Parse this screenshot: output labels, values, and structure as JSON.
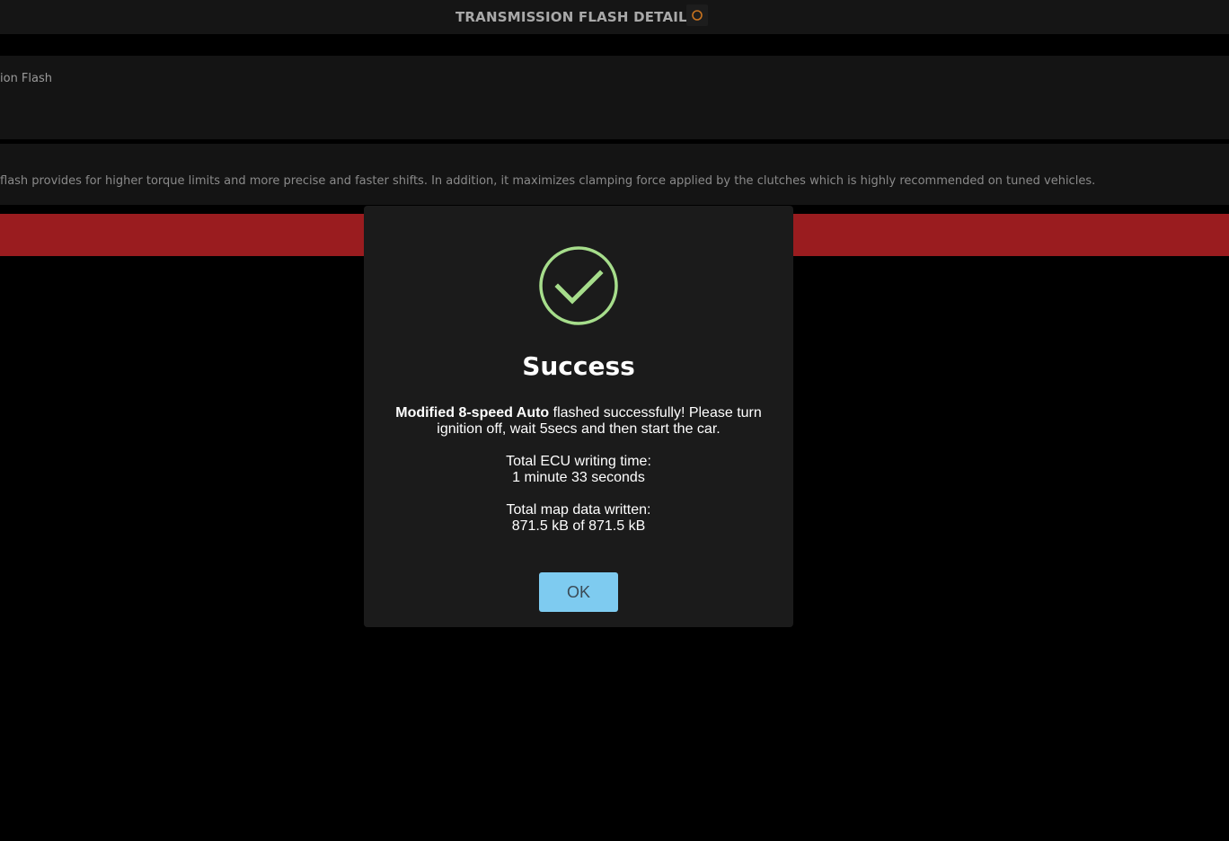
{
  "header": {
    "title": "TRANSMISSION FLASH DETAILS",
    "icon": "ring-icon",
    "icon_color": "#c8731f"
  },
  "panels": {
    "name_text": "ion Flash",
    "description_text": "flash provides for higher torque limits and more precise and faster shifts. In addition, it maximizes clamping force applied by the clutches which is highly recommended on tuned vehicles."
  },
  "colors": {
    "accent_red": "#9a1c1f",
    "success_green": "#a6dd8b",
    "button_blue": "#7ecbf0",
    "modal_bg": "#1b1b1b"
  },
  "modal": {
    "icon": "success-check-icon",
    "title": "Success",
    "message_bold": "Modified 8-speed Auto",
    "message_rest": " flashed successfully! Please turn ignition off, wait 5secs and then start the car.",
    "writing_time_label": "Total ECU writing time:",
    "writing_time_value": "1 minute 33 seconds",
    "map_data_label": "Total map data written:",
    "map_data_value": "871.5 kB of 871.5 kB",
    "ok_label": "OK"
  }
}
